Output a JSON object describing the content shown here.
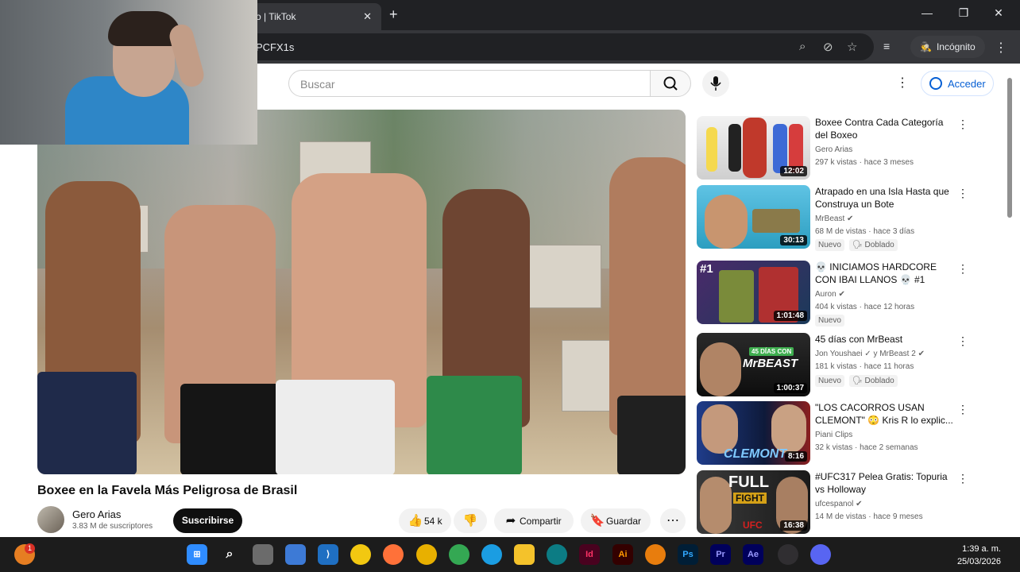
{
  "browser": {
    "tab_title": "o | TikTok",
    "tab_close": "✕",
    "new_tab": "+",
    "url": "PCFX1s",
    "incognito_label": "Incógnito",
    "minimize": "—",
    "maximize": "❐",
    "close": "✕"
  },
  "youtube": {
    "search_placeholder": "Buscar",
    "signin_label": "Acceder",
    "video": {
      "title": "Boxee en la Favela Más Peligrosa de Brasil",
      "channel": "Gero Arias",
      "subscribers": "3.83 M de suscriptores",
      "subscribe_label": "Suscribirse",
      "likes": "54 k",
      "share_label": "Compartir",
      "save_label": "Guardar"
    },
    "recommendations": [
      {
        "title": "Boxee Contra Cada Categoría del Boxeo",
        "channel": "Gero Arias",
        "meta": "297 k vistas · hace 3 meses",
        "duration": "12:02",
        "badges": []
      },
      {
        "title": "Atrapado en una Isla Hasta que Construya un Bote",
        "channel": "MrBeast",
        "meta": "68 M de vistas · hace 3 días",
        "duration": "30:13",
        "badges": [
          "Nuevo",
          "Doblado"
        ]
      },
      {
        "title": "💀 INICIAMOS HARDCORE CON IBAI LLANOS 💀 #1",
        "channel": "Auron",
        "meta": "404 k vistas · hace 12 horas",
        "duration": "1:01:48",
        "badges": [
          "Nuevo"
        ],
        "thumb_text": "#1"
      },
      {
        "title": "45 días con MrBeast",
        "channel": "Jon Youshaei ✓ y MrBeast 2",
        "meta": "181 k vistas · hace 11 horas",
        "duration": "1:00:37",
        "badges": [
          "Nuevo",
          "Doblado"
        ],
        "thumb_text_top": "45 DÍAS CON",
        "thumb_text": "MrBEAST"
      },
      {
        "title": "\"LOS CACORROS USAN CLEMONT\" 😳 Kris R lo explic...",
        "channel": "Piani Clips",
        "meta": "32 k vistas · hace 2 semanas",
        "duration": "8:16",
        "badges": [],
        "thumb_text": "CLEMONT"
      },
      {
        "title": "#UFC317 Pelea Gratis: Topuria vs Holloway",
        "channel": "ufcespanol",
        "meta": "14 M de vistas · hace 9 meses",
        "duration": "16:38",
        "badges": [],
        "thumb_text_top": "FULL",
        "thumb_text": "FIGHT",
        "thumb_text_bottom": "UFC"
      }
    ]
  },
  "taskbar": {
    "time": "1:39 a. m.",
    "date": "25/03/2026",
    "notification_count": "1",
    "apps": [
      "windows",
      "search",
      "task-view",
      "store",
      "vscode",
      "chrome-dev",
      "firefox",
      "chrome-canary",
      "chrome",
      "edge",
      "file-explorer",
      "edge-dev",
      "Id",
      "Ai",
      "blender",
      "Ps",
      "Pr",
      "Ae",
      "obs",
      "discord"
    ]
  },
  "colors": {
    "accent_blue": "#065fd4",
    "subscribe_bg": "#0f0f0f",
    "taskbar_bg": "#1c1c1c",
    "browser_bg": "#202124"
  }
}
